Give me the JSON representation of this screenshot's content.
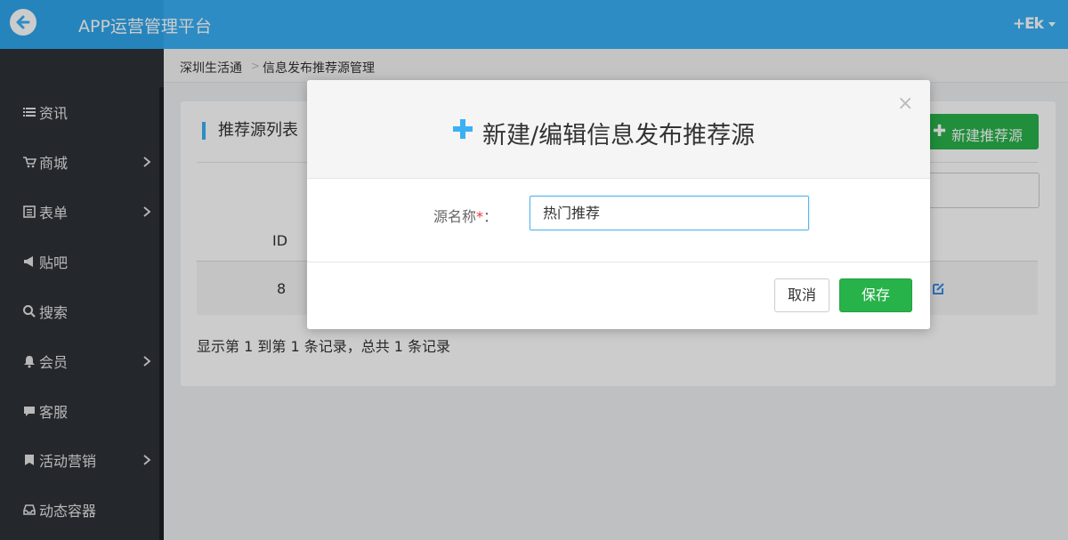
{
  "header": {
    "app_title": "APP运营管理平台",
    "user_name": "+Ek"
  },
  "sidebar": {
    "items": [
      {
        "label": "资讯",
        "icon": "list-icon",
        "has_children": false
      },
      {
        "label": "商城",
        "icon": "cart-icon",
        "has_children": true
      },
      {
        "label": "表单",
        "icon": "form-icon",
        "has_children": true
      },
      {
        "label": "贴吧",
        "icon": "megaphone-icon",
        "has_children": false
      },
      {
        "label": "搜索",
        "icon": "search-icon",
        "has_children": false
      },
      {
        "label": "会员",
        "icon": "bell-icon",
        "has_children": true
      },
      {
        "label": "客服",
        "icon": "chat-icon",
        "has_children": false
      },
      {
        "label": "活动营销",
        "icon": "bookmark-icon",
        "has_children": true
      },
      {
        "label": "动态容器",
        "icon": "inbox-icon",
        "has_children": false
      }
    ]
  },
  "breadcrumb": {
    "items": [
      "深圳生活通",
      "信息发布推荐源管理"
    ]
  },
  "panel": {
    "title": "推荐源列表",
    "add_button": "新建推荐源",
    "table": {
      "columns": [
        "ID"
      ],
      "rows": [
        {
          "id": "8"
        }
      ]
    },
    "footer": "显示第 1 到第 1 条记录，总共 1 条记录"
  },
  "modal": {
    "title": "新建/编辑信息发布推荐源",
    "close_symbol": "×",
    "field_label": "源名称",
    "field_required_mark": "*",
    "field_colon": "：",
    "field_value": "热门推荐",
    "cancel_label": "取消",
    "save_label": "保存"
  },
  "colors": {
    "topbar": "#3ab0f5",
    "sidebar": "#2d3138",
    "primary_green": "#28b24a",
    "accent_blue": "#3ab0f5"
  }
}
